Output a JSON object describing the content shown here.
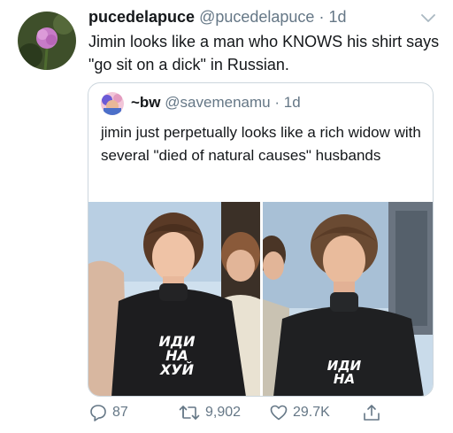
{
  "tweet": {
    "display_name": "pucedelapuce",
    "handle": "@pucedelapuce",
    "separator": "·",
    "time": "1d",
    "text": "Jimin looks like a man who KNOWS his shirt says \"go sit on a dick\" in Russian."
  },
  "quoted_tweet": {
    "display_name": "~bw",
    "handle": "@savemenamu",
    "separator": "·",
    "time": "1d",
    "text": "jimin just perpetually looks like a rich widow with several \"died of natural causes\" husbands",
    "photos": [
      {
        "shirt_text": [
          "ИДИ",
          "НА",
          "ХУЙ"
        ]
      },
      {
        "shirt_text": [
          "ИДИ",
          "НА"
        ]
      }
    ]
  },
  "actions": {
    "replies": "87",
    "retweets": "9,902",
    "likes": "29.7K"
  },
  "colors": {
    "text": "#14171a",
    "secondary": "#657786",
    "border": "#ccd6dd"
  },
  "icons": [
    "reply-icon",
    "retweet-icon",
    "like-icon",
    "share-icon",
    "chevron-down-icon"
  ]
}
